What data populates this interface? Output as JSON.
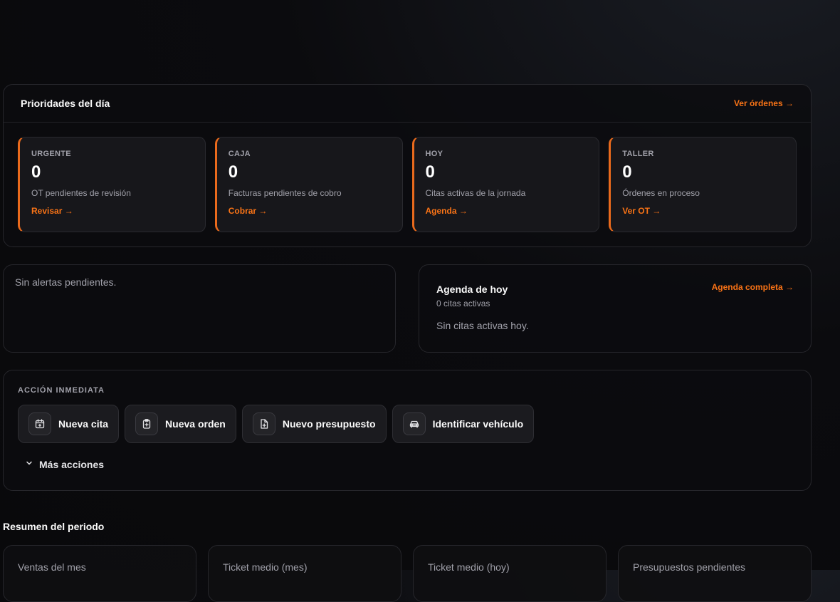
{
  "priorities": {
    "title": "Prioridades del día",
    "link": "Ver órdenes →",
    "cards": [
      {
        "tag": "URGENTE",
        "value": "0",
        "desc": "OT pendientes de revisión",
        "action": "Revisar →"
      },
      {
        "tag": "CAJA",
        "value": "0",
        "desc": "Facturas pendientes de cobro",
        "action": "Cobrar →"
      },
      {
        "tag": "HOY",
        "value": "0",
        "desc": "Citas activas de la jornada",
        "action": "Agenda →"
      },
      {
        "tag": "TALLER",
        "value": "0",
        "desc": "Órdenes en proceso",
        "action": "Ver OT →"
      }
    ]
  },
  "alerts": {
    "message": "Sin alertas pendientes."
  },
  "agenda": {
    "title": "Agenda de hoy",
    "subtitle": "0 citas activas",
    "link": "Agenda completa →",
    "empty": "Sin citas activas hoy."
  },
  "actions": {
    "label": "ACCIÓN INMEDIATA",
    "buttons": [
      {
        "label": "Nueva cita",
        "icon": "calendar-plus-icon"
      },
      {
        "label": "Nueva orden",
        "icon": "clipboard-plus-icon"
      },
      {
        "label": "Nuevo presupuesto",
        "icon": "file-plus-icon"
      },
      {
        "label": "Identificar vehículo",
        "icon": "car-icon"
      }
    ],
    "more": "Más acciones"
  },
  "summary": {
    "title": "Resumen del periodo",
    "stats": [
      "Ventas del mes",
      "Ticket medio (mes)",
      "Ticket medio (hoy)",
      "Presupuestos pendientes"
    ]
  },
  "colors": {
    "accent": "#f97316",
    "background": "#09090b",
    "card": "#17171b"
  }
}
